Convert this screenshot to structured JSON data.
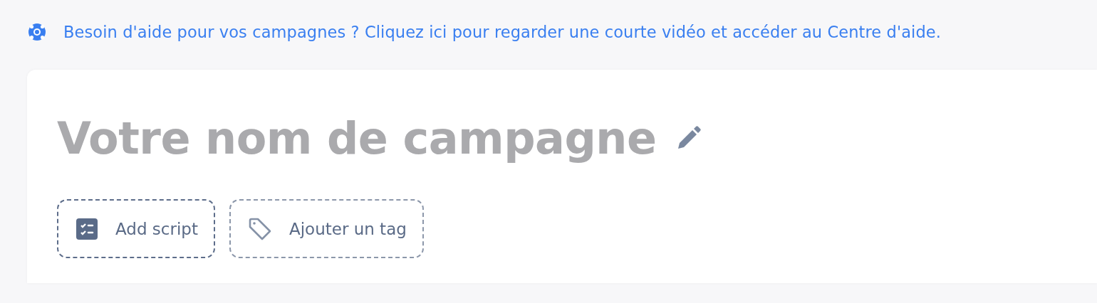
{
  "help_banner": {
    "text": "Besoin d'aide pour vos campagnes ? Cliquez ici pour regarder une courte vidéo et accéder au Centre d'aide."
  },
  "campaign": {
    "title": "Votre nom de campagne",
    "actions": [
      {
        "kind": "script",
        "label": "Add script"
      },
      {
        "kind": "tag",
        "label": "Ajouter un tag"
      }
    ]
  }
}
